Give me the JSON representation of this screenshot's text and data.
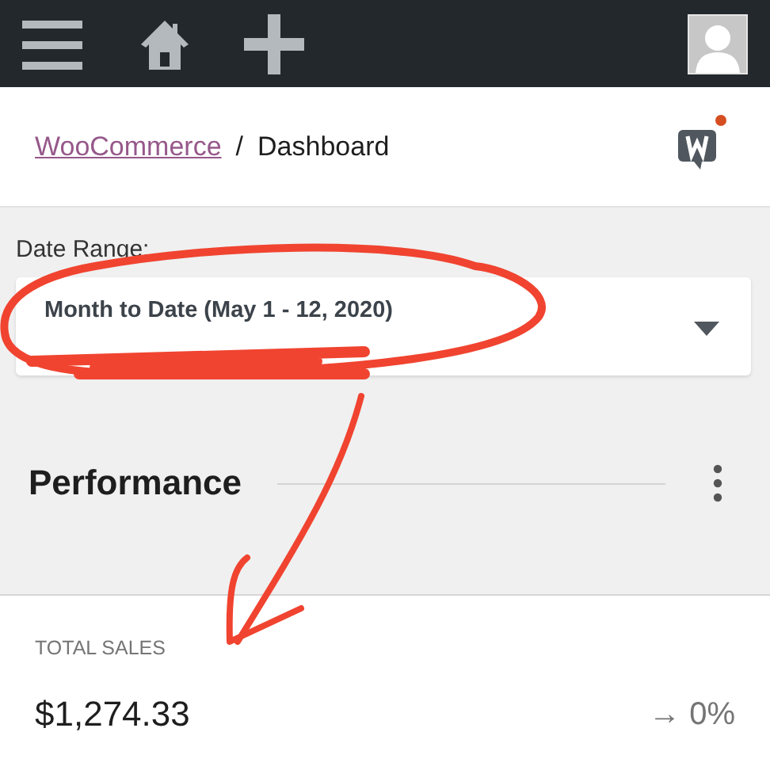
{
  "breadcrumb": {
    "link": "WooCommerce",
    "separator": "/",
    "current": "Dashboard"
  },
  "date_range": {
    "label": "Date Range:",
    "value": "Month to Date (May 1 - 12, 2020)"
  },
  "section": {
    "title": "Performance"
  },
  "metric": {
    "label": "TOTAL SALES",
    "value": "$1,274.33",
    "delta": "→ 0%"
  }
}
